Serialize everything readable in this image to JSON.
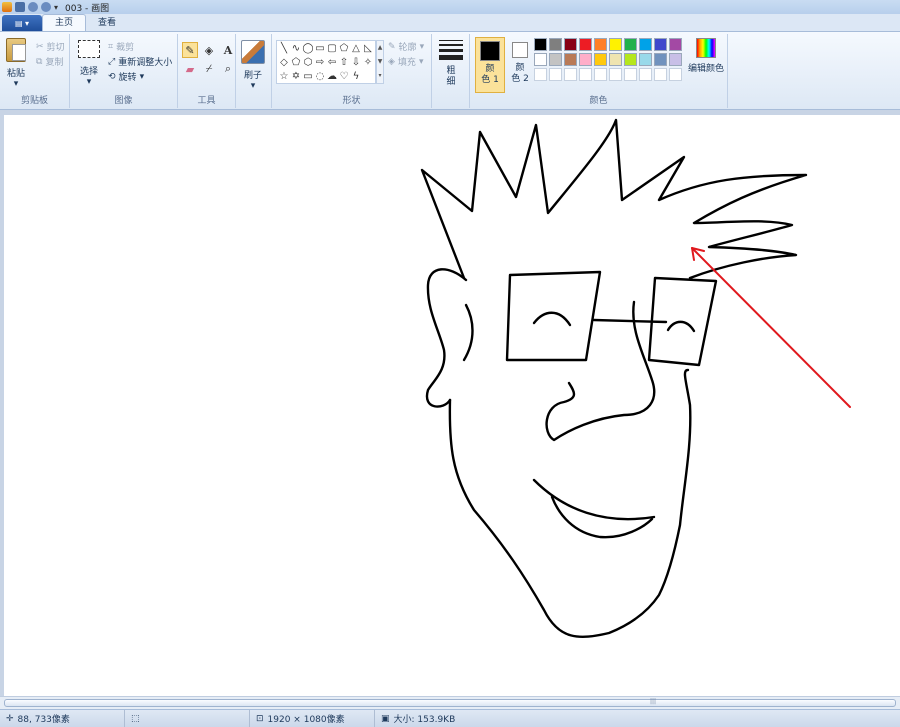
{
  "titlebar": {
    "title": "003 - 画图"
  },
  "tabs": [
    {
      "label": "主页",
      "active": true
    },
    {
      "label": "查看",
      "active": false
    }
  ],
  "clipboard": {
    "paste_label": "粘贴",
    "cut_label": "剪切",
    "copy_label": "复制",
    "group_label": "剪贴板"
  },
  "image": {
    "select_label": "选择",
    "crop_label": "裁剪",
    "resize_label": "重新调整大小",
    "rotate_label": "旋转",
    "group_label": "图像"
  },
  "tools": {
    "group_label": "工具",
    "text_tool_glyph": "A"
  },
  "brushes": {
    "label": "刷子"
  },
  "shapes": {
    "outline_label": "轮廓",
    "fill_label": "填充",
    "group_label": "形状"
  },
  "size": {
    "label_line1": "粗",
    "label_line2": "细"
  },
  "colors": {
    "color1_line1": "颜",
    "color1_line2": "色 1",
    "color2_line1": "颜",
    "color2_line2": "色 2",
    "edit_label": "编辑颜色",
    "group_label": "颜色",
    "palette": [
      "#000000",
      "#7f7f7f",
      "#880015",
      "#ed1c24",
      "#ff7f27",
      "#fff200",
      "#22b14c",
      "#00a2e8",
      "#3f48cc",
      "#a349a4",
      "#ffffff",
      "#c3c3c3",
      "#b97a57",
      "#ffaec9",
      "#ffc90e",
      "#efe4b0",
      "#b5e61d",
      "#99d9ea",
      "#7092be",
      "#c8bfe7",
      "#ffffff",
      "#ffffff",
      "#ffffff",
      "#ffffff",
      "#ffffff",
      "#ffffff",
      "#ffffff",
      "#ffffff",
      "#ffffff",
      "#ffffff"
    ]
  },
  "status": {
    "cursor_pos": "88, 733像素",
    "dimensions": "1920 × 1080像素",
    "file_size": "大小: 153.9KB"
  },
  "accent_colors": {
    "arrow": "#e0191e",
    "selected_tool_bg": "#fbe29a"
  }
}
